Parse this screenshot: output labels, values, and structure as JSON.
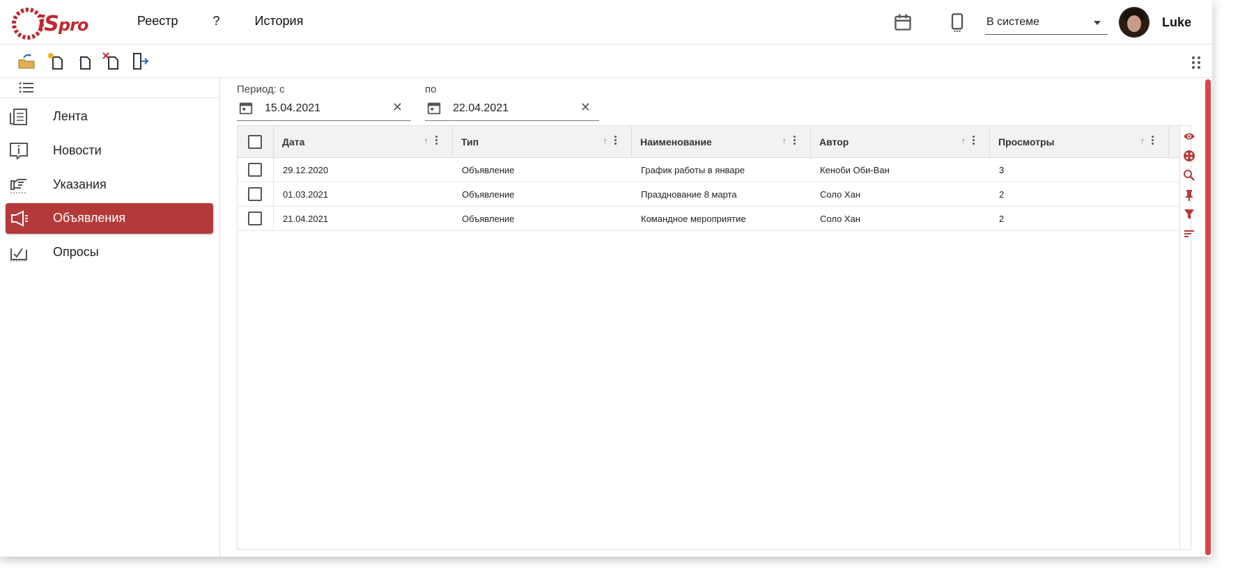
{
  "header": {
    "logo_main": "iS",
    "logo_sub": "pro",
    "menu": [
      {
        "label": "Реестр"
      },
      {
        "label": "?"
      },
      {
        "label": "История"
      }
    ],
    "status": "В системе",
    "username": "Luke"
  },
  "toolbar": {
    "buttons": [
      "open-folder",
      "create-document",
      "edit-document",
      "delete-document",
      "exit"
    ]
  },
  "sidebar": {
    "items": [
      {
        "label": "Лента",
        "icon": "feed-icon",
        "active": false
      },
      {
        "label": "Новости",
        "icon": "info-icon",
        "active": false
      },
      {
        "label": "Указания",
        "icon": "pointing-hand-icon",
        "active": false
      },
      {
        "label": "Объявления",
        "icon": "megaphone-icon",
        "active": true
      },
      {
        "label": "Опросы",
        "icon": "poll-icon",
        "active": false
      }
    ]
  },
  "filter": {
    "from_label": "Период: с",
    "from_value": "15.04.2021",
    "to_label": "по",
    "to_value": "22.04.2021",
    "clear_glyph": "✕"
  },
  "grid": {
    "columns": [
      {
        "label": "Дата"
      },
      {
        "label": "Тип"
      },
      {
        "label": "Наименование"
      },
      {
        "label": "Автор"
      },
      {
        "label": "Просмотры"
      }
    ],
    "rows": [
      {
        "date": "29.12.2020",
        "type": "Объявление",
        "name": "График работы в январе",
        "author": "Кеноби Оби-Ван",
        "views": "3"
      },
      {
        "date": "01.03.2021",
        "type": "Объявление",
        "name": "Празднование 8 марта",
        "author": "Соло Хан",
        "views": "2"
      },
      {
        "date": "21.04.2021",
        "type": "Объявление",
        "name": "Командное мероприятие",
        "author": "Соло Хан",
        "views": "2"
      }
    ],
    "side_tools": [
      "eye-icon",
      "palette-icon",
      "search-icon",
      "pin-icon",
      "filter-icon",
      "sort-icon"
    ]
  },
  "colors": {
    "accent": "#b43a3a",
    "brand": "#c0282f"
  }
}
